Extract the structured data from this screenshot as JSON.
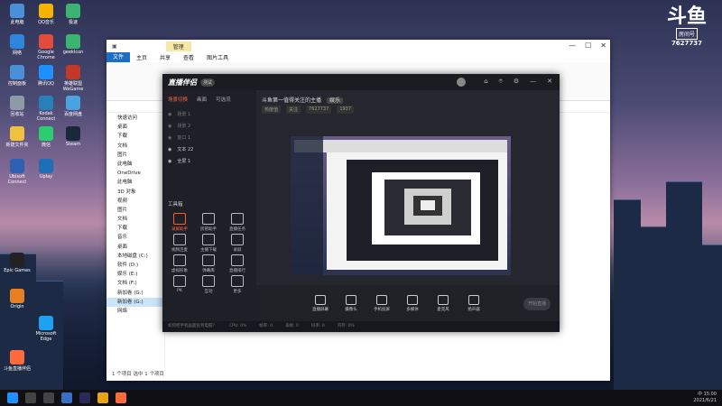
{
  "watermark": {
    "logo": "斗鱼",
    "sub": "房间号",
    "room": "7627737"
  },
  "desktop_icons": [
    {
      "label": "此电脑"
    },
    {
      "label": "QQ音乐"
    },
    {
      "label": "极速"
    },
    {
      "label": "网络"
    },
    {
      "label": "Google Chrome"
    },
    {
      "label": "geeklcon"
    },
    {
      "label": "控制面板"
    },
    {
      "label": "腾讯QQ"
    },
    {
      "label": "英雄联盟 WeGame"
    },
    {
      "label": "回收站"
    },
    {
      "label": "Kodak Connect"
    },
    {
      "label": "百度网盘"
    },
    {
      "label": "新建文件夹"
    },
    {
      "label": "微信"
    },
    {
      "label": "Steam"
    },
    {
      "label": "Ubisoft Connect"
    },
    {
      "label": "Uplay"
    },
    {
      "label": "Epic Games"
    },
    {
      "label": "Origin"
    },
    {
      "label": "Microsoft Edge"
    },
    {
      "label": "斗鱼直播伴侣"
    }
  ],
  "explorer": {
    "title_tab": "管理",
    "ribbon_tabs": [
      "文件",
      "主页",
      "共享",
      "查看",
      "图片工具"
    ],
    "sidebar": [
      "快速访问",
      "桌面",
      "下载",
      "文档",
      "图片",
      "此电脑",
      "OneDrive",
      "此电脑",
      "3D 对象",
      "视频",
      "图片",
      "文档",
      "下载",
      "音乐",
      "桌面",
      "本地磁盘 (C:)",
      "软件 (D:)",
      "娱乐 (E:)",
      "文档 (F:)",
      "新加卷 (G:)",
      "新加卷 (G:)",
      "网络"
    ],
    "status": "1 个项目    选中 1 个项目"
  },
  "app": {
    "logo": "直播伴侣",
    "version_badge": "测试",
    "left_tabs": [
      "场景切换",
      "画面",
      "可选流"
    ],
    "layers": [
      {
        "label": "场景 1",
        "on": false
      },
      {
        "label": "场景 2",
        "on": false
      },
      {
        "label": "窗口 1",
        "on": false
      },
      {
        "label": "文本 22",
        "on": true
      },
      {
        "label": "全屏 1",
        "on": true
      }
    ],
    "tools_title": "工具箱",
    "tools": [
      {
        "label": "录屏助手",
        "red": true
      },
      {
        "label": "房管助手",
        "red": false
      },
      {
        "label": "直播任务",
        "red": false
      },
      {
        "label": "视频连麦",
        "red": false
      },
      {
        "label": "主播下载",
        "red": false
      },
      {
        "label": "录屏",
        "red": false
      },
      {
        "label": "虚拟形象",
        "red": false
      },
      {
        "label": "弹幕库",
        "red": false
      },
      {
        "label": "直播排行",
        "red": false
      },
      {
        "label": "PK",
        "red": false
      },
      {
        "label": "互动",
        "red": false
      },
      {
        "label": "更多",
        "red": false
      }
    ],
    "room_title": "斗鱼第一值得关注的主播",
    "room_tag": "娱乐",
    "room_meta": [
      "热度值",
      "关注",
      "7627737",
      "1937"
    ],
    "bottom_buttons": [
      "直播屏幕",
      "摄像头",
      "手机投屏",
      "多媒体",
      "麦克风",
      "扬声器"
    ],
    "start_label": "开始直播",
    "status_items": [
      "如何把手机画面投到电脑？",
      "CPU: 0%",
      "帧率: 0",
      "丢帧: 0",
      "码率: 0",
      "内存: 0%"
    ]
  },
  "taskbar": {
    "time": "15:00",
    "date": "2021/6/21",
    "lang": "中"
  }
}
